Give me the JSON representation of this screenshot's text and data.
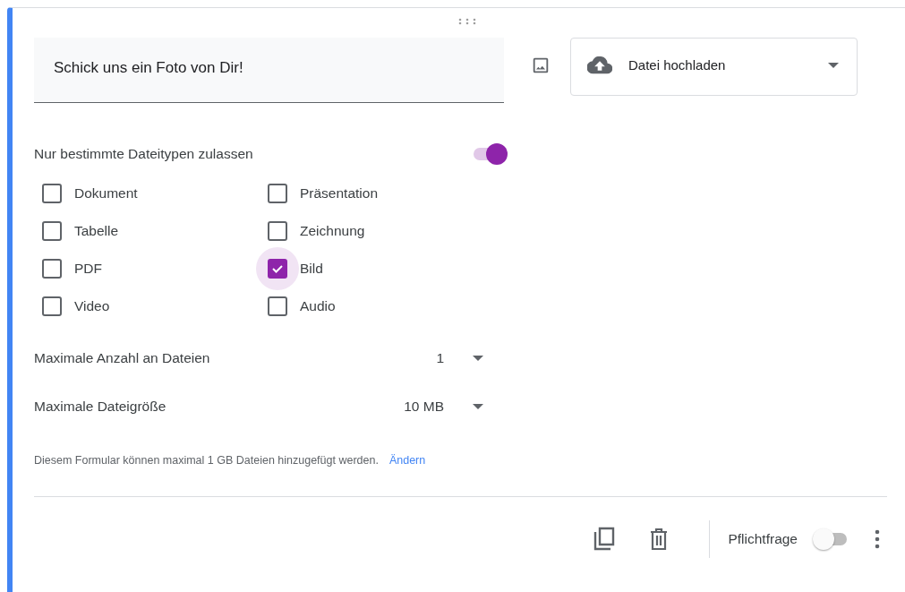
{
  "question": {
    "value": "Schick uns ein Foto von Dir!"
  },
  "type_dropdown": {
    "label": "Datei hochladen"
  },
  "file_types_toggle": {
    "label": "Nur bestimmte Dateitypen zulassen",
    "on": true
  },
  "file_types": [
    {
      "label": "Dokument",
      "checked": false
    },
    {
      "label": "Präsentation",
      "checked": false
    },
    {
      "label": "Tabelle",
      "checked": false
    },
    {
      "label": "Zeichnung",
      "checked": false
    },
    {
      "label": "PDF",
      "checked": false
    },
    {
      "label": "Bild",
      "checked": true
    },
    {
      "label": "Video",
      "checked": false
    },
    {
      "label": "Audio",
      "checked": false
    }
  ],
  "settings": [
    {
      "label": "Maximale Anzahl an Dateien",
      "value": "1"
    },
    {
      "label": "Maximale Dateigröße",
      "value": "10 MB"
    }
  ],
  "note": {
    "text": "Diesem Formular können maximal 1 GB Dateien hinzugefügt werden.",
    "link": "Ändern"
  },
  "footer": {
    "required_label": "Pflichtfrage",
    "required_on": false
  }
}
